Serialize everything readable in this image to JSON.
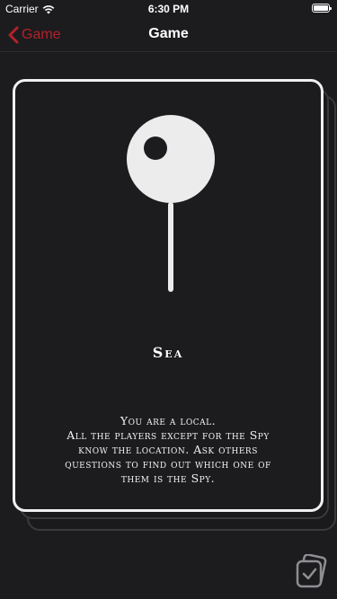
{
  "status_bar": {
    "carrier": "Carrier",
    "time": "6:30 PM"
  },
  "nav": {
    "back_label": "Game",
    "title": "Game"
  },
  "card": {
    "location": "Sea",
    "role_lines": [
      "You are a local.",
      "All the players except for the Spy",
      "know the location. Ask others",
      "questions to find out which one of",
      "them is the Spy."
    ]
  },
  "icons": {
    "back": "chevron-left-icon",
    "pin": "map-pin-icon",
    "corner": "check-card-icon",
    "wifi": "wifi-icon",
    "battery": "battery-icon"
  },
  "colors": {
    "background": "#1c1c1e",
    "accent": "#b3212a",
    "card_border": "#f0f0f0"
  }
}
